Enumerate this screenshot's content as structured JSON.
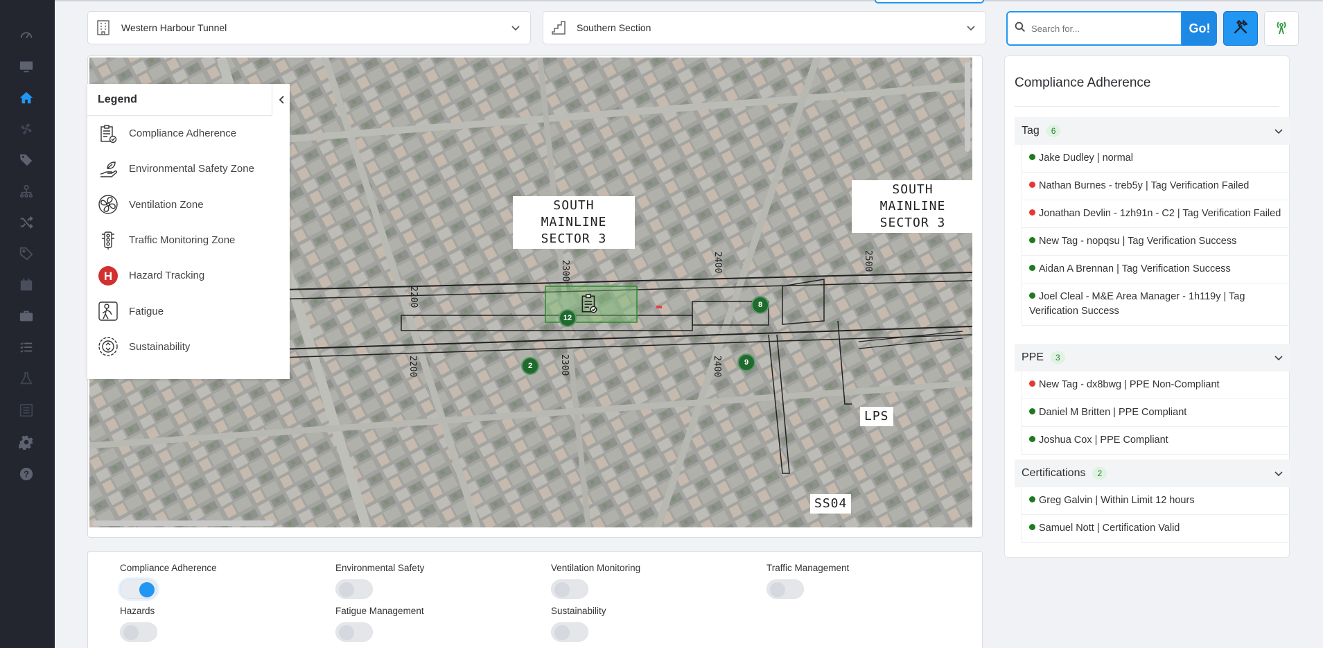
{
  "sidebar": {
    "items": [
      {
        "icon": "dashboard-gauge-icon"
      },
      {
        "icon": "monitor-icon"
      },
      {
        "icon": "home-icon"
      },
      {
        "icon": "fan-icon"
      },
      {
        "icon": "tags-icon"
      },
      {
        "icon": "org-chart-icon"
      },
      {
        "icon": "shuffle-icon"
      },
      {
        "icon": "tag-outline-icon"
      },
      {
        "icon": "calendar-icon"
      },
      {
        "icon": "briefcase-icon"
      },
      {
        "icon": "checklist-icon"
      },
      {
        "icon": "flask-icon"
      },
      {
        "icon": "list-box-icon"
      },
      {
        "icon": "gear-icon"
      },
      {
        "icon": "help-icon"
      }
    ]
  },
  "site_select": {
    "value": "Western Harbour Tunnel"
  },
  "section_select": {
    "value": "Southern Section"
  },
  "search": {
    "placeholder": "Search for...",
    "button": "Go!"
  },
  "legend": {
    "title": "Legend",
    "items": [
      {
        "label": "Compliance Adherence",
        "icon": "clipboard-check-icon"
      },
      {
        "label": "Environmental Safety Zone",
        "icon": "leaf-hand-icon"
      },
      {
        "label": "Ventilation Zone",
        "icon": "fan-icon"
      },
      {
        "label": "Traffic Monitoring Zone",
        "icon": "traffic-light-icon"
      },
      {
        "label": "Hazard Tracking",
        "icon": "hazard-h-icon"
      },
      {
        "label": "Fatigue",
        "icon": "tired-person-icon"
      },
      {
        "label": "Sustainability",
        "icon": "recycle-gear-icon"
      }
    ]
  },
  "map": {
    "labels": {
      "sector_a_line1": "SOUTH MAINLINE",
      "sector_a_line2": "SECTOR 3",
      "sector_b_line1": "SOUTH MAINLINE",
      "sector_b_line2": "SECTOR 3",
      "lps": "LPS",
      "ss04": "SS04"
    },
    "markers": [
      "12",
      "8",
      "2",
      "9"
    ],
    "chainages": [
      "2200",
      "2300",
      "2400",
      "2500"
    ]
  },
  "toggles": [
    {
      "label": "Compliance Adherence",
      "on": true
    },
    {
      "label": "Environmental Safety",
      "on": false
    },
    {
      "label": "Ventilation Monitoring",
      "on": false
    },
    {
      "label": "Traffic Management",
      "on": false
    },
    {
      "label": "Hazards",
      "on": false
    },
    {
      "label": "Fatigue Management",
      "on": false
    },
    {
      "label": "Sustainability",
      "on": false
    }
  ],
  "compliance": {
    "title": "Compliance Adherence",
    "sections": [
      {
        "name": "Tag",
        "count": "6",
        "entries": [
          {
            "text": "Jake Dudley | normal",
            "status": "green"
          },
          {
            "text": "Nathan Burnes - treb5y | Tag Verification Failed",
            "status": "red"
          },
          {
            "text": "Jonathan Devlin - 1zh91n - C2 | Tag Verification Failed",
            "status": "red"
          },
          {
            "text": "New Tag - nopqsu | Tag Verification Success",
            "status": "green"
          },
          {
            "text": "Aidan A Brennan | Tag Verification Success",
            "status": "green"
          },
          {
            "text": "Joel Cleal - M&E Area Manager - 1h119y | Tag Verification Success",
            "status": "green"
          }
        ]
      },
      {
        "name": "PPE",
        "count": "3",
        "entries": [
          {
            "text": "New Tag - dx8bwg | PPE Non-Compliant",
            "status": "red"
          },
          {
            "text": "Daniel M Britten | PPE Compliant",
            "status": "green"
          },
          {
            "text": "Joshua Cox | PPE Compliant",
            "status": "green"
          }
        ]
      },
      {
        "name": "Certifications",
        "count": "2",
        "entries": [
          {
            "text": "Greg Galvin | Within Limit 12 hours",
            "status": "green"
          },
          {
            "text": "Samuel Nott | Certification Valid",
            "status": "green"
          }
        ]
      }
    ]
  },
  "colors": {
    "accent": "#2196f3",
    "sidebar": "#23252f",
    "status_green": "#1e7a1e",
    "status_red": "#e53935",
    "marker": "#1f6b2e"
  }
}
